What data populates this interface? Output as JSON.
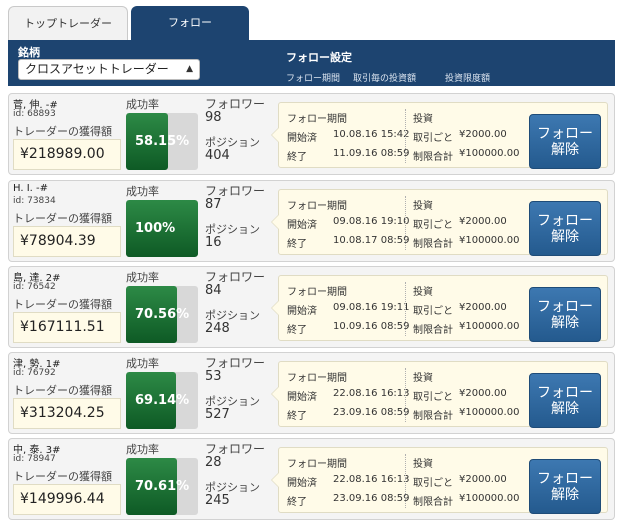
{
  "tabs": [
    {
      "label": "トップトレーダー"
    },
    {
      "label": "フォロー"
    }
  ],
  "header": {
    "symbol_label": "銘柄",
    "select_value": "クロスアセットトレーダー",
    "follow_settings": "フォロー設定",
    "col_period": "フォロー期間",
    "col_per_trade": "取引毎の投資額",
    "col_limit": "投資限度額"
  },
  "labels": {
    "earnings": "トレーダーの獲得額",
    "success_rate": "成功率",
    "followers": "フォロワー",
    "positions": "ポジション",
    "period": "フォロー期間",
    "started": "開始済",
    "ended": "終了",
    "investment": "投資",
    "per_trade": "取引ごと",
    "limit_total": "制限合計",
    "unfollow_1": "フォロー",
    "unfollow_2": "解除"
  },
  "traders": [
    {
      "name": "菅, 伸.  -#",
      "id": "id: 68893",
      "earnings": "¥218989.00",
      "success": 0.5815,
      "success_text": "58.15%",
      "followers": "98",
      "positions": "404",
      "start": "10.08.16 15:42",
      "end": "11.09.16 08:59",
      "per_trade": "¥2000.00",
      "limit": "¥100000.00"
    },
    {
      "name": "H. I.  -#",
      "id": "id: 73834",
      "earnings": "¥78904.39",
      "success": 1.0,
      "success_text": "100%",
      "followers": "87",
      "positions": "16",
      "start": "09.08.16 19:10",
      "end": "10.08.17 08:59",
      "per_trade": "¥2000.00",
      "limit": "¥100000.00"
    },
    {
      "name": "島, 達.  2#",
      "id": "id: 76542",
      "earnings": "¥167111.51",
      "success": 0.7056,
      "success_text": "70.56%",
      "followers": "84",
      "positions": "248",
      "start": "09.08.16 19:11",
      "end": "10.09.16 08:59",
      "per_trade": "¥2000.00",
      "limit": "¥100000.00"
    },
    {
      "name": "津, 勢.  1#",
      "id": "id: 76792",
      "earnings": "¥313204.25",
      "success": 0.6914,
      "success_text": "69.14%",
      "followers": "53",
      "positions": "527",
      "start": "22.08.16 16:13",
      "end": "23.09.16 08:59",
      "per_trade": "¥2000.00",
      "limit": "¥100000.00"
    },
    {
      "name": "中, 泰.  3#",
      "id": "id: 78947",
      "earnings": "¥149996.44",
      "success": 0.7061,
      "success_text": "70.61%",
      "followers": "28",
      "positions": "245",
      "start": "22.08.16 16:13",
      "end": "23.09.16 08:59",
      "per_trade": "¥2000.00",
      "limit": "¥100000.00"
    }
  ]
}
